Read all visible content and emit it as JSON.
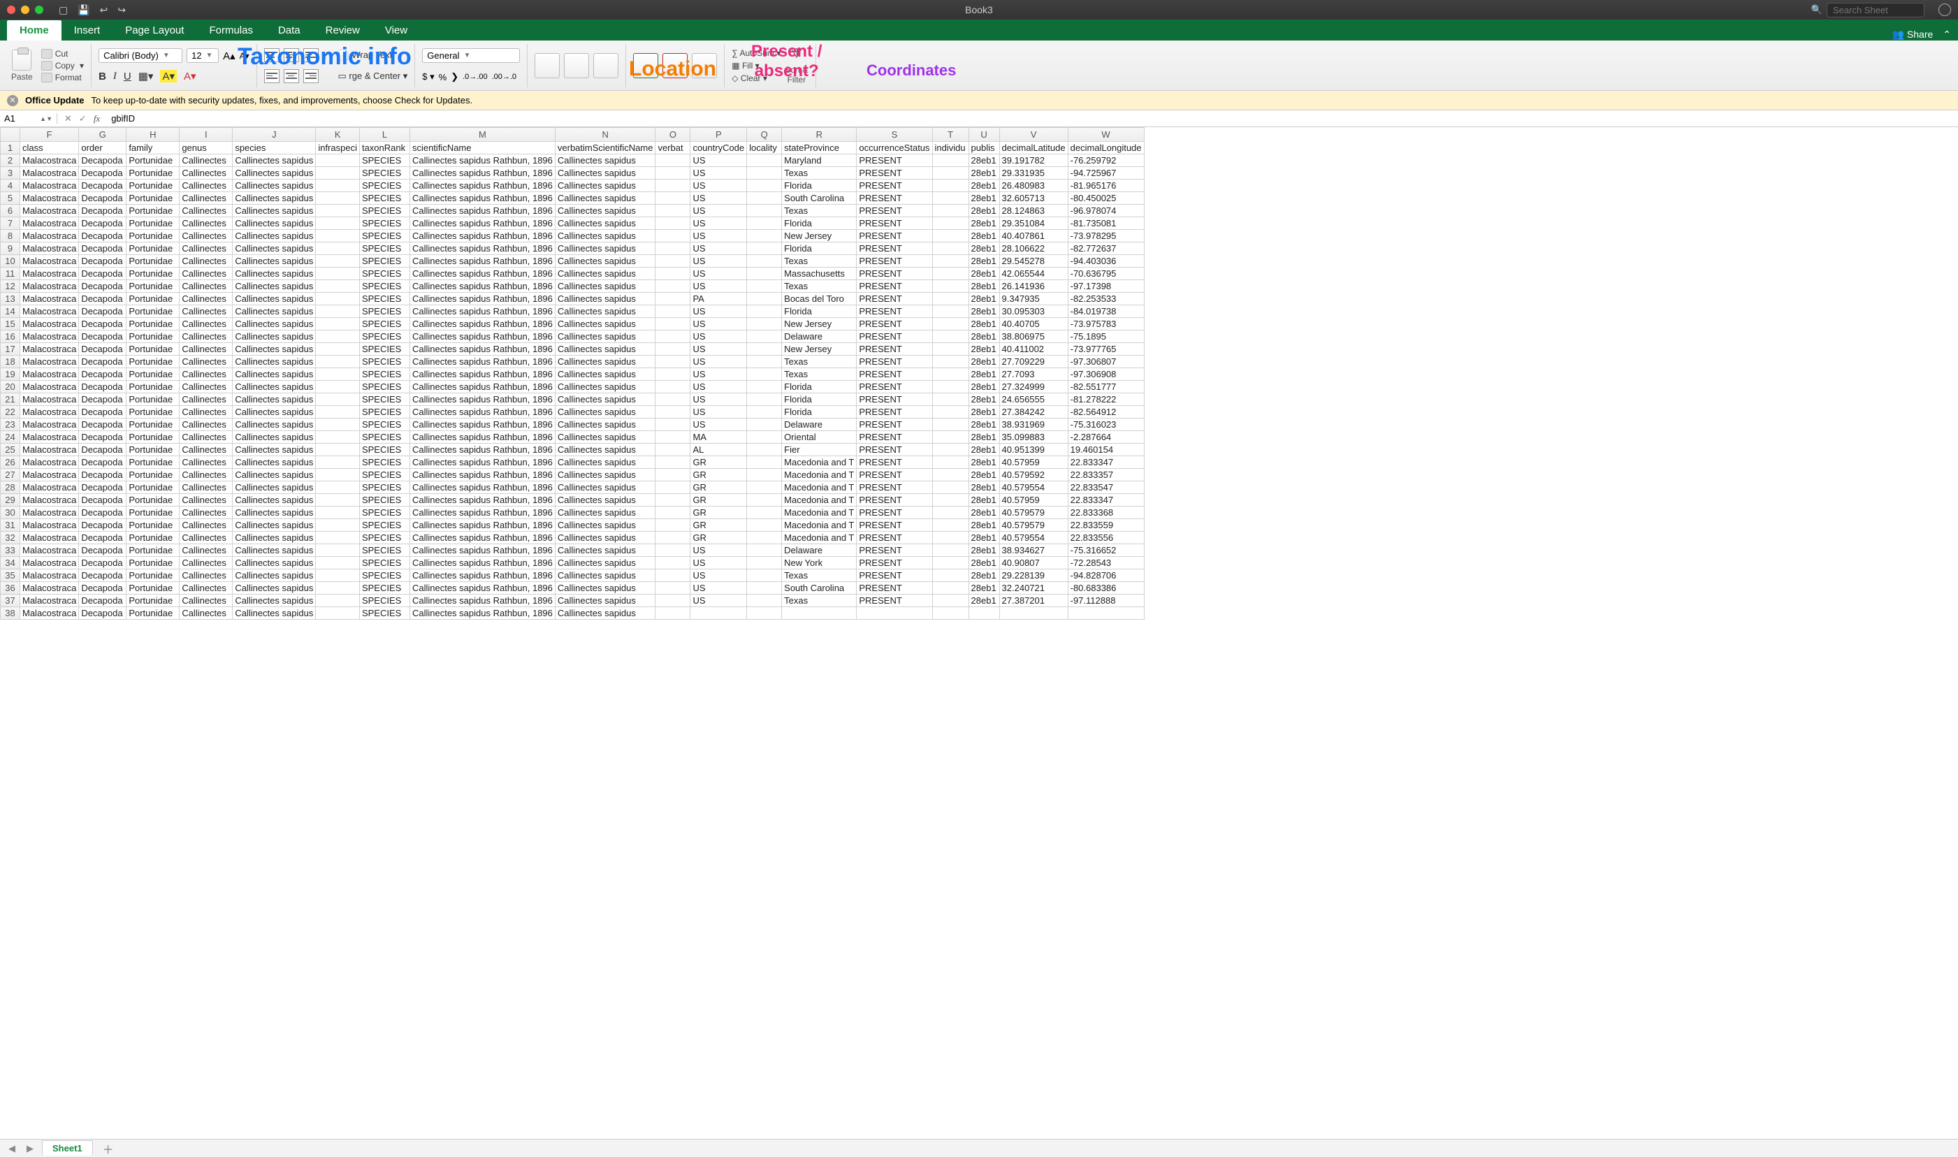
{
  "window": {
    "title": "Book3",
    "search_placeholder": "Search Sheet"
  },
  "tabs": {
    "items": [
      "Home",
      "Insert",
      "Page Layout",
      "Formulas",
      "Data",
      "Review",
      "View"
    ],
    "share": "Share"
  },
  "ribbon": {
    "paste": "Paste",
    "cut": "Cut",
    "copy": "Copy",
    "format": "Format",
    "font_name": "Calibri (Body)",
    "font_size": "12",
    "wrap": "Wrap Text",
    "merge": "rge & Center",
    "number_format": "General",
    "autosum": "AutoSum",
    "fill": "Fill",
    "clear": "Clear",
    "sort": "Sort &",
    "filter": "Filter"
  },
  "annotations": {
    "taxonomic": "Taxonomic info",
    "location": "Location",
    "present": "Present /\nabsent?",
    "coords": "Coordinates"
  },
  "update_bar": {
    "title": "Office Update",
    "msg": "To keep up-to-date with security updates, fixes, and improvements, choose Check for Updates."
  },
  "formula": {
    "cellref": "A1",
    "value": "gbifID"
  },
  "columns_letters": [
    "F",
    "G",
    "H",
    "I",
    "J",
    "K",
    "L",
    "M",
    "N",
    "O",
    "P",
    "Q",
    "R",
    "S",
    "T",
    "U",
    "V",
    "W"
  ],
  "headers": [
    "class",
    "order",
    "family",
    "genus",
    "species",
    "infraspeci",
    "taxonRank",
    "scientificName",
    "verbatimScientificName",
    "verbat",
    "countryCode",
    "locality",
    "stateProvince",
    "occurrenceStatus",
    "individu",
    "publis",
    "decimalLatitude",
    "decimalLongitude"
  ],
  "rows": [
    {
      "P": "US",
      "R": "Maryland",
      "V": "39.191782",
      "W": "-76.259792"
    },
    {
      "P": "US",
      "R": "Texas",
      "V": "29.331935",
      "W": "-94.725967"
    },
    {
      "P": "US",
      "R": "Florida",
      "V": "26.480983",
      "W": "-81.965176"
    },
    {
      "P": "US",
      "R": "South Carolina",
      "V": "32.605713",
      "W": "-80.450025"
    },
    {
      "P": "US",
      "R": "Texas",
      "V": "28.124863",
      "W": "-96.978074"
    },
    {
      "P": "US",
      "R": "Florida",
      "V": "29.351084",
      "W": "-81.735081"
    },
    {
      "P": "US",
      "R": "New Jersey",
      "V": "40.407861",
      "W": "-73.978295"
    },
    {
      "P": "US",
      "R": "Florida",
      "V": "28.106622",
      "W": "-82.772637"
    },
    {
      "P": "US",
      "R": "Texas",
      "V": "29.545278",
      "W": "-94.403036"
    },
    {
      "P": "US",
      "R": "Massachusetts",
      "V": "42.065544",
      "W": "-70.636795"
    },
    {
      "P": "US",
      "R": "Texas",
      "V": "26.141936",
      "W": "-97.17398"
    },
    {
      "P": "PA",
      "R": "Bocas del Toro",
      "V": "9.347935",
      "W": "-82.253533"
    },
    {
      "P": "US",
      "R": "Florida",
      "V": "30.095303",
      "W": "-84.019738"
    },
    {
      "P": "US",
      "R": "New Jersey",
      "V": "40.40705",
      "W": "-73.975783"
    },
    {
      "P": "US",
      "R": "Delaware",
      "V": "38.806975",
      "W": "-75.1895"
    },
    {
      "P": "US",
      "R": "New Jersey",
      "V": "40.411002",
      "W": "-73.977765"
    },
    {
      "P": "US",
      "R": "Texas",
      "V": "27.709229",
      "W": "-97.306807"
    },
    {
      "P": "US",
      "R": "Texas",
      "V": "27.7093",
      "W": "-97.306908"
    },
    {
      "P": "US",
      "R": "Florida",
      "V": "27.324999",
      "W": "-82.551777"
    },
    {
      "P": "US",
      "R": "Florida",
      "V": "24.656555",
      "W": "-81.278222"
    },
    {
      "P": "US",
      "R": "Florida",
      "V": "27.384242",
      "W": "-82.564912"
    },
    {
      "P": "US",
      "R": "Delaware",
      "V": "38.931969",
      "W": "-75.316023"
    },
    {
      "P": "MA",
      "R": "Oriental",
      "V": "35.099883",
      "W": "-2.287664"
    },
    {
      "P": "AL",
      "R": "Fier",
      "V": "40.951399",
      "W": "19.460154"
    },
    {
      "P": "GR",
      "R": "Macedonia and T",
      "V": "40.57959",
      "W": "22.833347"
    },
    {
      "P": "GR",
      "R": "Macedonia and T",
      "V": "40.579592",
      "W": "22.833357"
    },
    {
      "P": "GR",
      "R": "Macedonia and T",
      "V": "40.579554",
      "W": "22.833547"
    },
    {
      "P": "GR",
      "R": "Macedonia and T",
      "V": "40.57959",
      "W": "22.833347"
    },
    {
      "P": "GR",
      "R": "Macedonia and T",
      "V": "40.579579",
      "W": "22.833368"
    },
    {
      "P": "GR",
      "R": "Macedonia and T",
      "V": "40.579579",
      "W": "22.833559"
    },
    {
      "P": "GR",
      "R": "Macedonia and T",
      "V": "40.579554",
      "W": "22.833556"
    },
    {
      "P": "US",
      "R": "Delaware",
      "V": "38.934627",
      "W": "-75.316652"
    },
    {
      "P": "US",
      "R": "New York",
      "V": "40.90807",
      "W": "-72.28543"
    },
    {
      "P": "US",
      "R": "Texas",
      "V": "29.228139",
      "W": "-94.828706"
    },
    {
      "P": "US",
      "R": "South Carolina",
      "V": "32.240721",
      "W": "-80.683386"
    },
    {
      "P": "US",
      "R": "Texas",
      "V": "27.387201",
      "W": "-97.112888"
    }
  ],
  "constants": {
    "class": "Malacostraca",
    "order": "Decapoda",
    "family": "Portunidae",
    "genus": "Callinectes",
    "species": "Callinectes sapidus",
    "taxonRank": "SPECIES",
    "sciName": "Callinectes sapidus Rathbun, 1896",
    "verbatim": "Callinectes sapidus",
    "status": "PRESENT",
    "publis": "28eb1"
  },
  "sheet_tab": "Sheet1"
}
